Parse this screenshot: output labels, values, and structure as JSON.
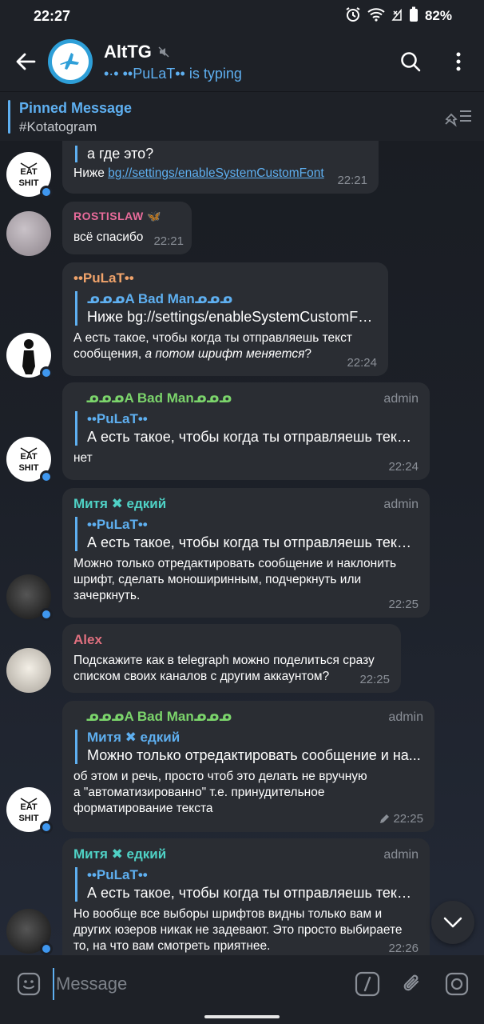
{
  "status_bar": {
    "time": "22:27",
    "battery": "82%"
  },
  "header": {
    "title": "AltTG",
    "subtitle": "•·• ••PuLaT•• is typing"
  },
  "pinned": {
    "title": "Pinned Message",
    "text": "#Kotatogram"
  },
  "messages": [
    {
      "reply_text": "а где это?",
      "text_prefix": "Ниже ",
      "link": "bg://settings/enableSystemCustomFont",
      "time": "22:21"
    },
    {
      "sender": "ROSTISLAW 🦋",
      "text": "всё спасибо",
      "time": "22:21"
    },
    {
      "sender": "••PuLaT••",
      "reply_name": "ᓄᓄᓄA Bad Manᓄᓄᓄ",
      "reply_text": "Ниже bg://settings/enableSystemCustomFont",
      "text": "А есть такое, чтобы когда ты отправляешь текст сообщения,",
      "text_italic": " а потом шрифт меняется",
      "text_end": "?",
      "time": "22:24"
    },
    {
      "sender": "ᓄᓄᓄA Bad Manᓄᓄᓄ",
      "badge": "admin",
      "reply_name": "••PuLaT••",
      "reply_text": "А есть такое, чтобы когда ты отправляешь текст...",
      "text": "нет",
      "time": "22:24"
    },
    {
      "sender": "Митя ✖ едкий",
      "badge": "admin",
      "reply_name": "••PuLaT••",
      "reply_text": "А есть такое, чтобы когда ты отправляешь текст...",
      "text": "Можно только отредактировать сообщение и наклонить шрифт, сделать моноширинным, подчеркнуть или зачеркнуть.",
      "time": "22:25"
    },
    {
      "sender": "Alex",
      "text": "Подскажите как в telegraph можно поделиться сразу списком своих каналов с другим аккаунтом?",
      "time": "22:25"
    },
    {
      "sender": "ᓄᓄᓄA Bad Manᓄᓄᓄ",
      "badge": "admin",
      "reply_name": "Митя ✖ едкий",
      "reply_text": "Можно только отредактировать сообщение и на...",
      "text": "об этом и речь, просто чтоб это делать не вручную а \"автоматизированно\" т.е. принудительное форматирование текста",
      "time": "22:25"
    },
    {
      "sender": "Митя ✖ едкий",
      "badge": "admin",
      "reply_name": "••PuLaT••",
      "reply_text": "А есть такое, чтобы когда ты отправляешь текст...",
      "text": "Но вообще все выборы шрифтов видны только вам и других юзеров никак не задевают. Это просто выбираете то, на что вам смотреть приятнее.",
      "time": "22:26"
    }
  ],
  "composer": {
    "placeholder": "Message"
  },
  "colors": {
    "accent": "#5eaff0",
    "pulat": "#f0a36b",
    "badman": "#7bd46b",
    "mitya": "#4fd1c5",
    "rostislaw": "#e86b9a",
    "alex": "#e0707f"
  }
}
